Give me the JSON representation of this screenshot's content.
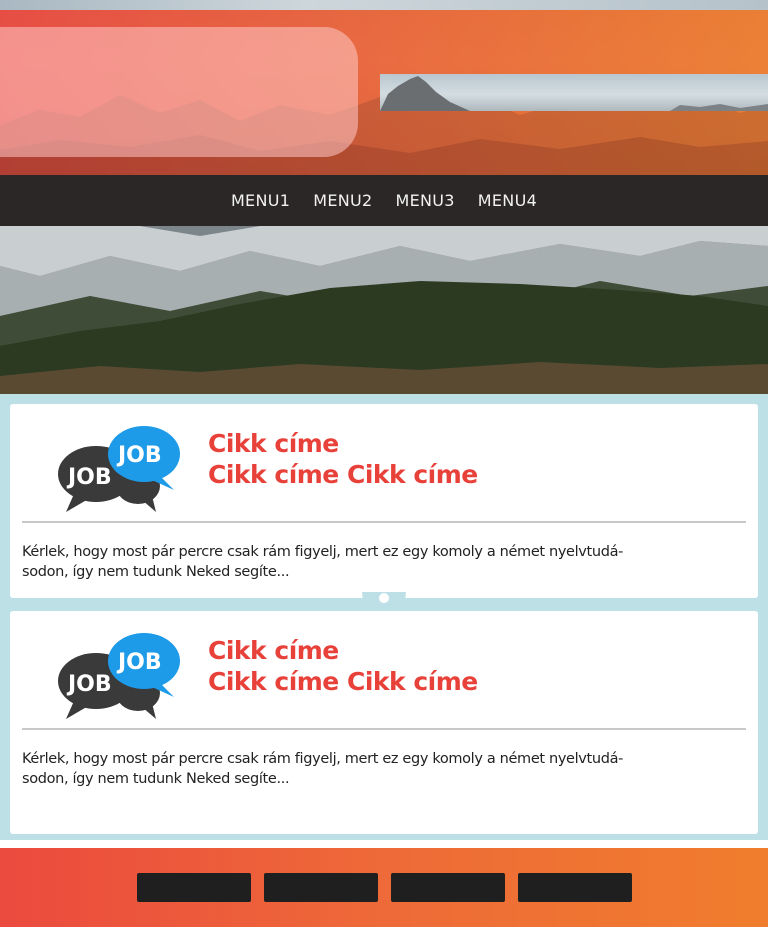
{
  "nav": {
    "items": [
      "MENU1",
      "MENU2",
      "MENU3",
      "MENU4"
    ]
  },
  "articles": [
    {
      "logo_text": [
        "JOB",
        "JOB"
      ],
      "title_lines": [
        "Cikk címe",
        "Cikk címe Cikk címe"
      ],
      "excerpt_lines": [
        "Kérlek, hogy most pár percre csak rám figyelj, mert ez egy komoly  a német nyelvtudá-",
        "sodon, így nem tudunk Neked segíte..."
      ]
    },
    {
      "logo_text": [
        "JOB",
        "JOB"
      ],
      "title_lines": [
        "Cikk címe",
        "Cikk címe Cikk címe"
      ],
      "excerpt_lines": [
        "Kérlek, hogy most pár percre csak rám figyelj, mert ez egy komoly  a német nyelvtudá-",
        "sodon, így nem tudunk Neked segíte..."
      ]
    }
  ],
  "colors": {
    "accent_red": "#e8413a",
    "accent_orange": "#f07d2d",
    "nav_bg": "#2a2726",
    "content_bg": "#bde0e6",
    "logo_bubble_dark": "#3a3a3a",
    "logo_bubble_blue": "#1e9be8"
  },
  "icons": {
    "logo": "job-speech-bubbles-icon",
    "connector": "timeline-connector-icon"
  }
}
